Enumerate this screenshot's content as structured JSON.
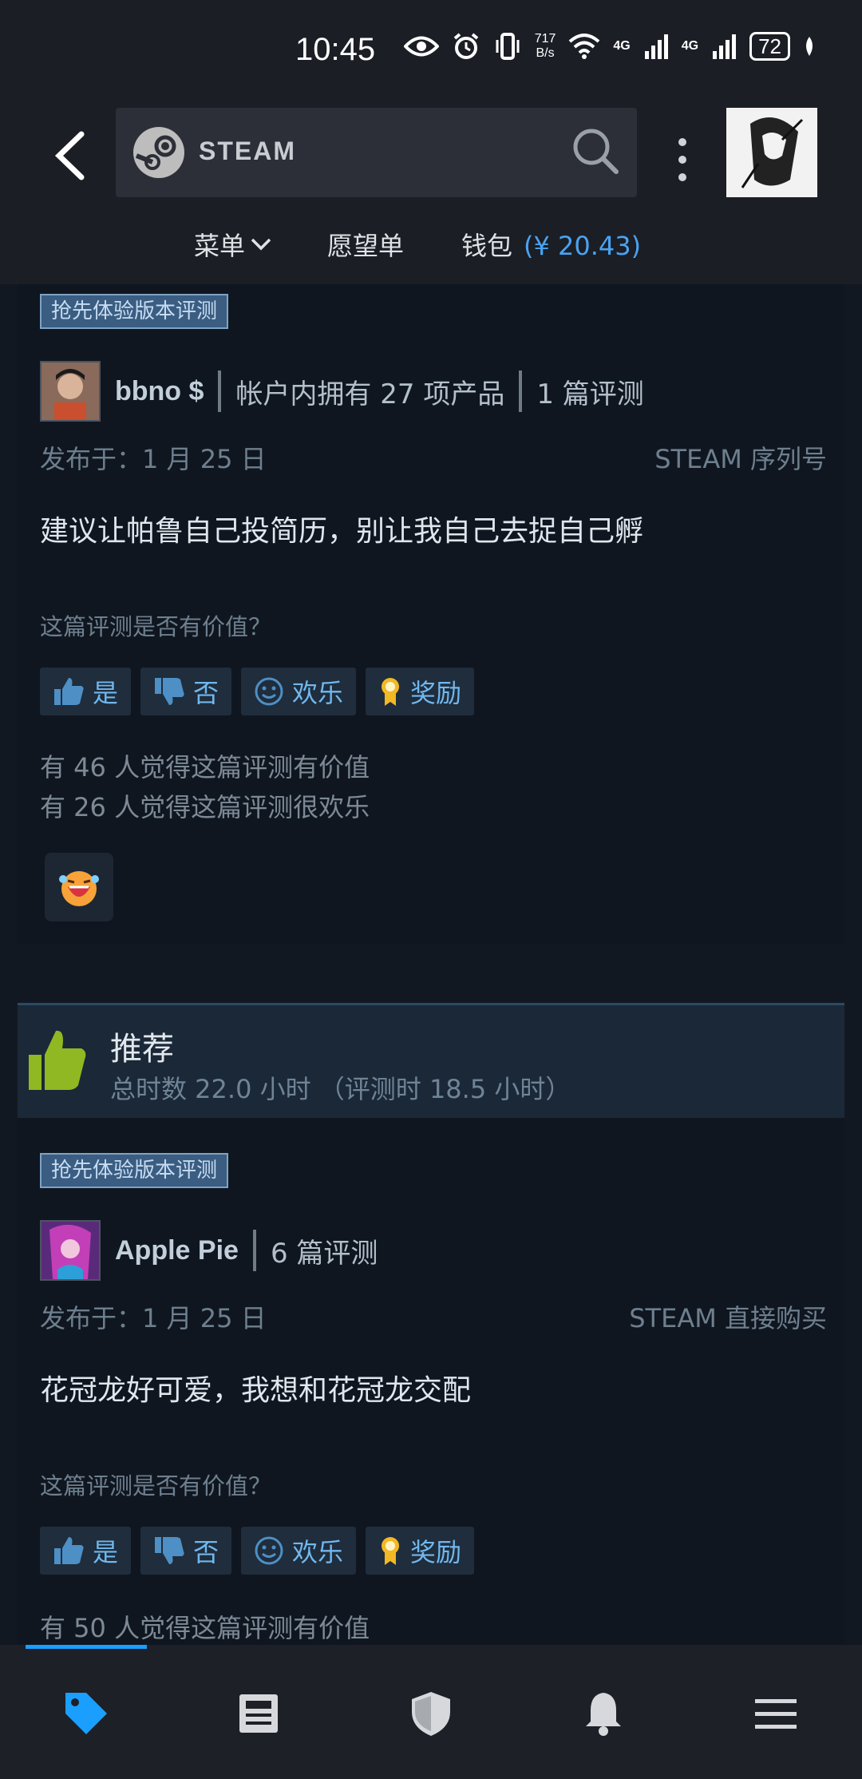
{
  "status_bar": {
    "time": "10:45",
    "speed_value": "717",
    "speed_unit": "B/s",
    "net1": "4G",
    "net2": "4G",
    "battery": "72"
  },
  "header": {
    "search_brand": "STEAM",
    "nav": {
      "menu": "菜单",
      "wishlist": "愿望单",
      "wallet_label": "钱包",
      "wallet_balance": "(¥ 20.43)"
    }
  },
  "reviews": [
    {
      "tag": "抢先体验版本评测",
      "name": "bbno $",
      "products": "帐户内拥有 27 项产品",
      "review_count": "1 篇评测",
      "posted": "发布于：1 月 25 日",
      "source": "STEAM 序列号",
      "text": "建议让帕鲁自己投简历，别让我自己去捉自己孵",
      "helpful_question": "这篇评测是否有价值？",
      "buttons": {
        "yes": "是",
        "no": "否",
        "funny": "欢乐",
        "award": "奖励"
      },
      "stat_helpful": "有 46 人觉得这篇评测有价值",
      "stat_funny": "有 26 人觉得这篇评测很欢乐"
    },
    {
      "recommend_label": "推荐",
      "hours": "总时数 22.0 小时 （评测时 18.5 小时）",
      "tag": "抢先体验版本评测",
      "name": "Apple Pie",
      "review_count": "6 篇评测",
      "posted": "发布于：1 月 25 日",
      "source": "STEAM 直接购买",
      "text": "花冠龙好可爱，我想和花冠龙交配",
      "helpful_question": "这篇评测是否有价值？",
      "buttons": {
        "yes": "是",
        "no": "否",
        "funny": "欢乐",
        "award": "奖励"
      },
      "stat_helpful": "有 50 人觉得这篇评测有价值"
    }
  ],
  "colors": {
    "accent": "#1a9fff",
    "wallet": "#4aa3f2",
    "recommend_thumb": "#8fb823"
  }
}
